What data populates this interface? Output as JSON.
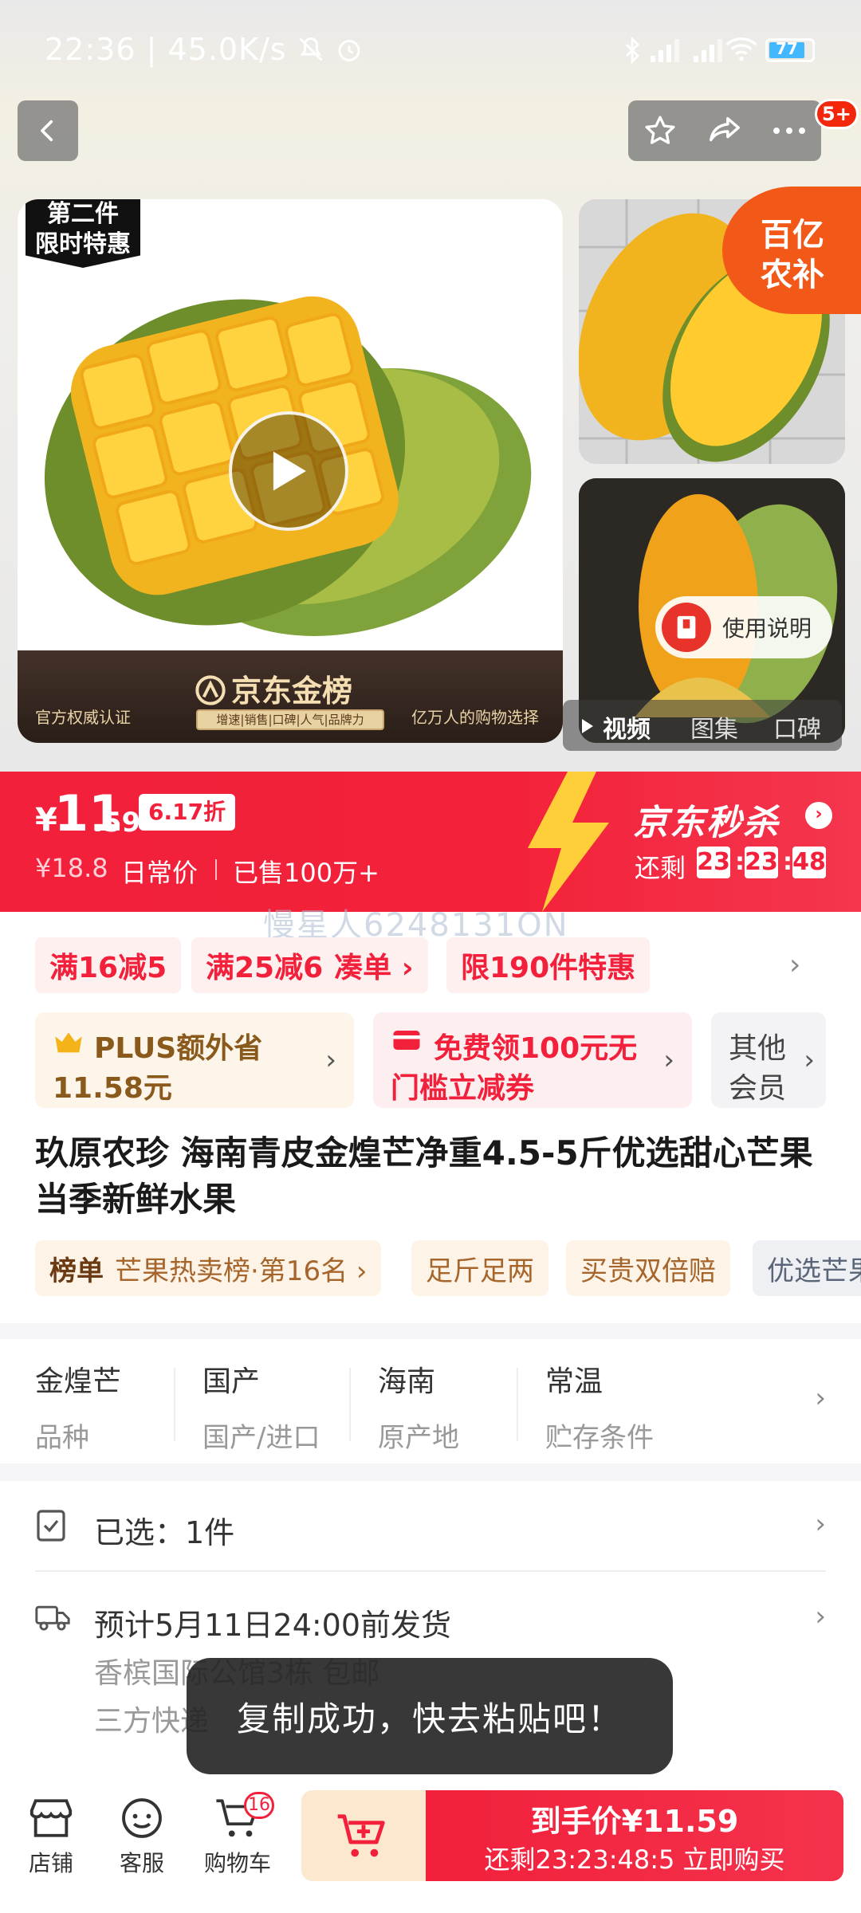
{
  "status_bar": {
    "time_speed": "22:36 | 45.0K/s",
    "battery": "77"
  },
  "header": {
    "message_badge": "5+"
  },
  "gallery": {
    "sticker_line1": "第二件",
    "sticker_line2": "限时特惠",
    "banner_left": "官方权威认证",
    "banner_title": "京东金榜",
    "banner_tags": "增速|销售|口碑|人气|品牌力",
    "banner_right": "亿万人的购物选择",
    "promo_line1": "百亿",
    "promo_line2": "农补",
    "usage_label": "使用说明",
    "tabs": [
      "视频",
      "图集",
      "口碑"
    ]
  },
  "price": {
    "currency": "¥",
    "integer": "11",
    "decimal": ".59",
    "discount": "6.17折",
    "original": "¥18.8",
    "original_label": "日常价",
    "sold": "已售100万+",
    "seckill_title": "京东秒杀",
    "countdown_label": "还剩",
    "countdown": [
      "23",
      "23",
      "48"
    ]
  },
  "watermark": "慢星人6248131ON",
  "coupons": [
    "满16减5",
    "满25减6",
    "凑单 ›",
    "限190件特惠"
  ],
  "plus_card": {
    "line1": "PLUS额外省",
    "line2": "11.58元"
  },
  "voucher_card": {
    "line1": "免费领100元无",
    "line2": "门槛立减券"
  },
  "member_card": {
    "line1": "其他",
    "line2": "会员"
  },
  "product_title": "玖原农珍 海南青皮金煌芒净重4.5-5斤优选甜心芒果 当季新鲜水果",
  "tags": {
    "rank_label": "榜单",
    "rank_value": "芒果热卖榜·第16名 ›",
    "weight": "足斤足两",
    "refund": "买贵双倍赔",
    "select": "优选芒果"
  },
  "specs": [
    {
      "value": "金煌芒",
      "label": "品种"
    },
    {
      "value": "国产",
      "label": "国产/进口"
    },
    {
      "value": "海南",
      "label": "原产地"
    },
    {
      "value": "常温",
      "label": "贮存条件"
    }
  ],
  "selected_row": "已选：1件",
  "shipping": {
    "eta": "预计5月11日24:00前发货",
    "address": "香槟国际公馆3栋  包邮",
    "courier": "三方快递"
  },
  "toast": "复制成功，快去粘贴吧！",
  "bottom_nav": {
    "store": "店铺",
    "service": "客服",
    "cart": "购物车",
    "cart_count": "16"
  },
  "buy_button": {
    "line1": "到手价¥11.59",
    "line2": "还剩23:23:48:5  立即购买"
  },
  "colors": {
    "accent_red": "#f2203b",
    "seckill_bg": "#f3223a",
    "promo_orange": "#f25818"
  }
}
